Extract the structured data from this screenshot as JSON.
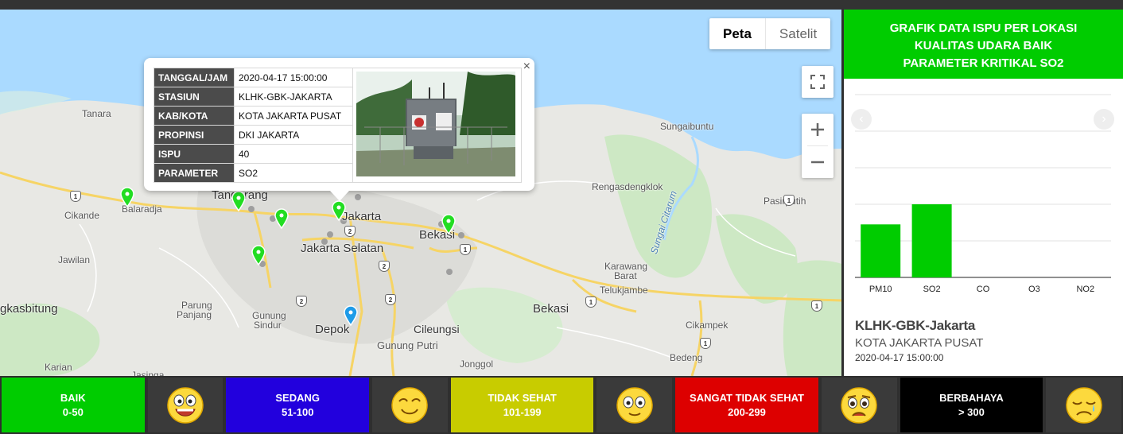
{
  "map": {
    "maptype": {
      "map_label": "Peta",
      "satellite_label": "Satelit"
    },
    "places": [
      {
        "name": "Tanara"
      },
      {
        "name": "Sungaibuntu"
      },
      {
        "name": "Tangerang"
      },
      {
        "name": "Balaradja"
      },
      {
        "name": "Cikande"
      },
      {
        "name": "Jakarta"
      },
      {
        "name": "Bekasi"
      },
      {
        "name": "Jakarta Selatan"
      },
      {
        "name": "Rengasdengklok"
      },
      {
        "name": "Pasirputih"
      },
      {
        "name": "Sungai Citarum"
      },
      {
        "name": "Jawilan"
      },
      {
        "name": "Karawang"
      },
      {
        "name": "Barat"
      },
      {
        "name": "Telukjambe"
      },
      {
        "name": "gkasbitung"
      },
      {
        "name": "Parung"
      },
      {
        "name": "Panjang"
      },
      {
        "name": "Gunung"
      },
      {
        "name": "Sindur"
      },
      {
        "name": "Depok"
      },
      {
        "name": "Cileungsi"
      },
      {
        "name": "Bekasi"
      },
      {
        "name": "Gunung Putri"
      },
      {
        "name": "Cikampek"
      },
      {
        "name": "Karian"
      },
      {
        "name": "Jonggol"
      },
      {
        "name": "Bedeng"
      },
      {
        "name": "Jasinga"
      }
    ],
    "shields": [
      "1",
      "2",
      "2",
      "2",
      "2",
      "1",
      "1",
      "1",
      "1",
      "1"
    ]
  },
  "popup": {
    "rows": [
      {
        "label": "TANGGAL/JAM",
        "value": "2020-04-17 15:00:00"
      },
      {
        "label": "STASIUN",
        "value": "KLHK-GBK-JAKARTA"
      },
      {
        "label": "KAB/KOTA",
        "value": "KOTA JAKARTA PUSAT"
      },
      {
        "label": "PROPINSI",
        "value": "DKI JAKARTA"
      },
      {
        "label": "ISPU",
        "value": "40"
      },
      {
        "label": "PARAMETER",
        "value": "SO2"
      }
    ],
    "close_symbol": "×"
  },
  "panel": {
    "title_line1": "GRAFIK DATA ISPU PER LOKASI",
    "title_line2": "KUALITAS UDARA BAIK",
    "title_line3": "PARAMETER KRITIKAL SO2",
    "header_color": "#00cc00",
    "station_name": "KLHK-GBK-Jakarta",
    "station_city": "KOTA JAKARTA PUSAT",
    "station_time": "2020-04-17 15:00:00",
    "prev_symbol": "‹",
    "next_symbol": "›"
  },
  "chart_data": {
    "type": "bar",
    "categories": [
      "PM10",
      "SO2",
      "CO",
      "O3",
      "NO2"
    ],
    "values": [
      29,
      40,
      0,
      0,
      0
    ],
    "ylim": [
      0,
      100
    ],
    "bar_color": "#00cc00",
    "grid": true
  },
  "legend": [
    {
      "label": "BAIK",
      "range": "0-50",
      "bg": "#00cc00",
      "fg": "#ffffff",
      "face": "grinning-face-icon"
    },
    {
      "label": "SEDANG",
      "range": "51-100",
      "bg": "#2200dd",
      "fg": "#ffffff",
      "face": "smiling-face-icon"
    },
    {
      "label": "TIDAK SEHAT",
      "range": "101-199",
      "bg": "#c8cc00",
      "fg": "#ffffff",
      "face": "neutral-face-icon"
    },
    {
      "label": "SANGAT TIDAK SEHAT",
      "range": "200-299",
      "bg": "#dd0000",
      "fg": "#ffffff",
      "face": "worried-face-icon"
    },
    {
      "label": "BERBAHAYA",
      "range": "> 300",
      "bg": "#000000",
      "fg": "#ffffff",
      "face": "sick-face-icon"
    }
  ]
}
